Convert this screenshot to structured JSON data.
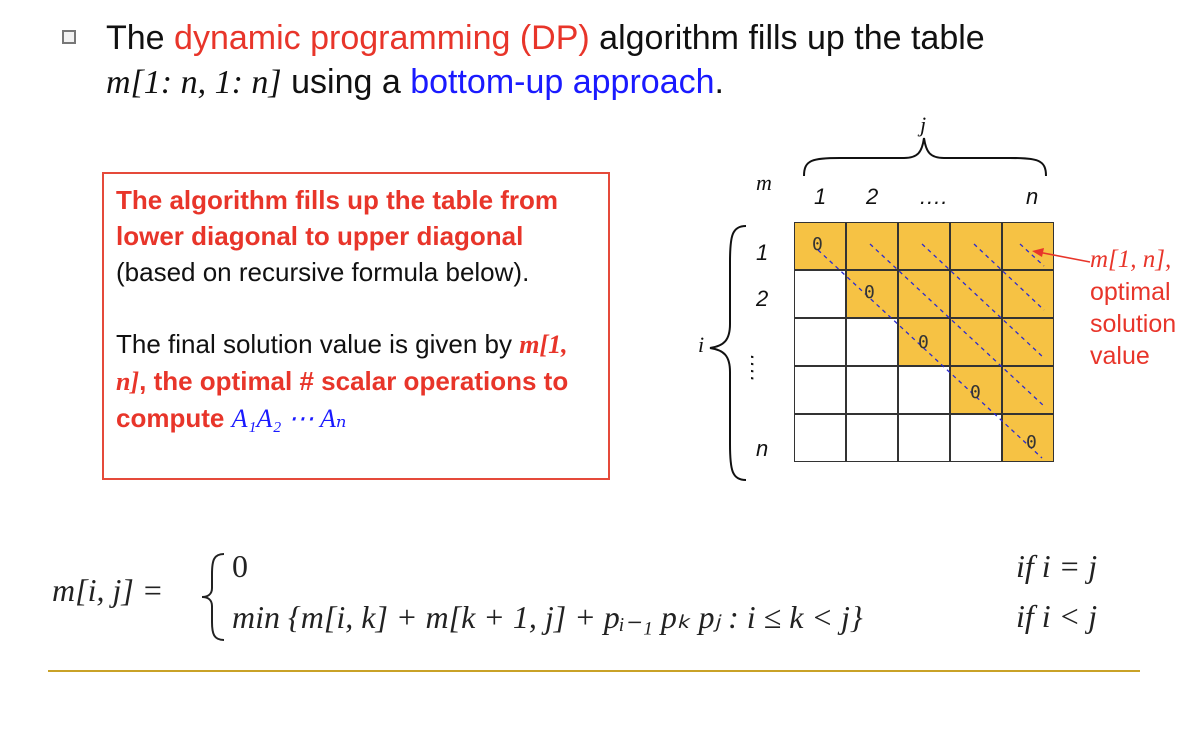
{
  "headline": {
    "part1": "The ",
    "highlight_red": "dynamic programming (DP)",
    "part2": " algorithm fills up the table",
    "line2_math": "m[1: n, 1: n]",
    "line2_text": " using a ",
    "highlight_blue": "bottom-up approach",
    "line2_end": "."
  },
  "callout": {
    "bold1": "The algorithm fills up the table from lower diagonal to upper diagonal",
    "normal1": " (based on recursive formula below).",
    "normal2": "The final solution value is given by ",
    "math_bold": "m[1, n]",
    "bold2": ", the optimal # scalar operations to compute ",
    "math_blue": "A₁A₂ ⋯ Aₙ"
  },
  "table": {
    "m_label": "m",
    "j_label": "j",
    "i_label": "i",
    "col_labels": [
      "1",
      "2",
      "....",
      "n"
    ],
    "row_labels": [
      "1",
      "2",
      "....",
      "n"
    ],
    "diag_value": "0"
  },
  "annotation": {
    "math": "m[1, n],",
    "line1": "optimal",
    "line2": "solution",
    "line3": "value"
  },
  "formula": {
    "lhs": "m[i, j] =",
    "case1_value": "0",
    "case1_cond": "if i = j",
    "case2_value": "min {m[i, k] + m[k + 1, j] + pᵢ₋₁ pₖ pⱼ : i ≤ k < j}",
    "case2_cond": "if i < j"
  },
  "colors": {
    "accent_red": "#e8352a",
    "accent_blue": "#1a1aff",
    "cell_fill": "#f6c244",
    "divider": "#c9a227"
  }
}
